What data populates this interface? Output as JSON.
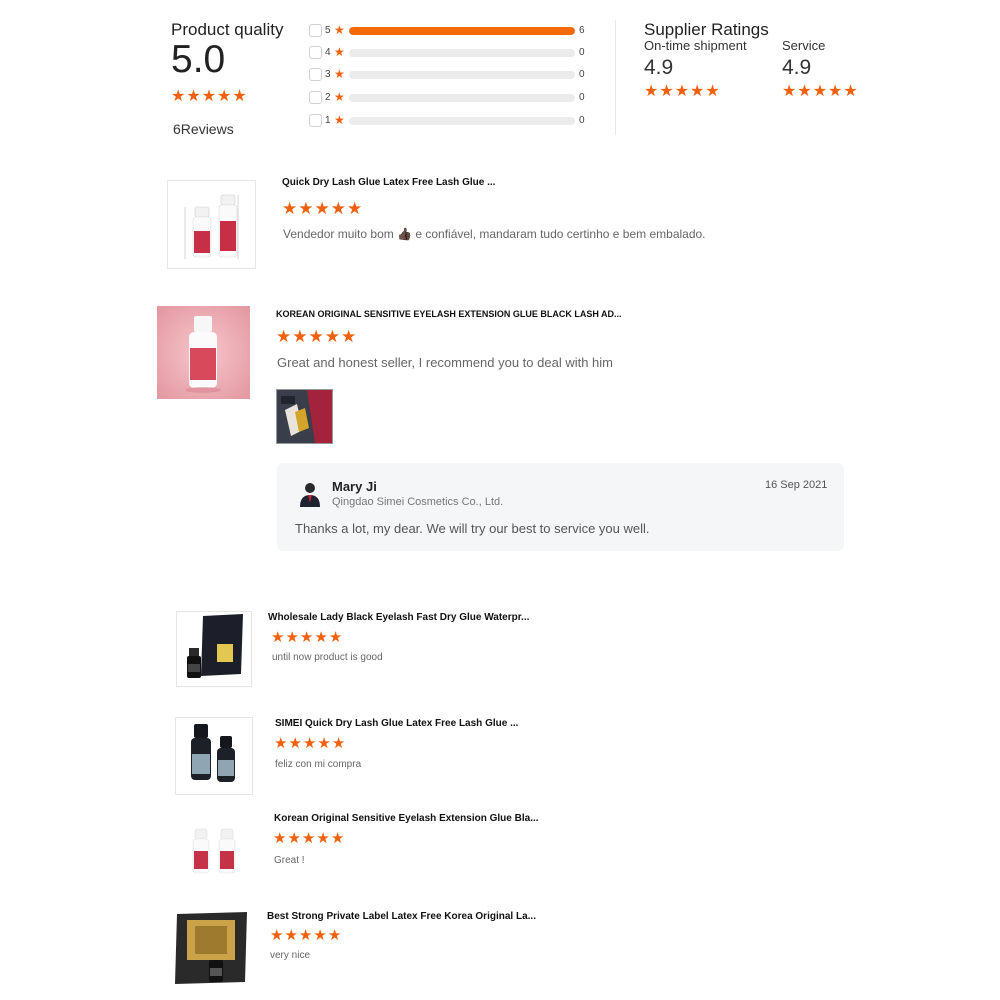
{
  "summary": {
    "title": "Product quality",
    "score": "5.0",
    "reviews_count": "6",
    "reviews_label": "Reviews",
    "distribution": [
      {
        "stars": "5",
        "count": "6",
        "fraction": 1.0
      },
      {
        "stars": "4",
        "count": "0",
        "fraction": 0
      },
      {
        "stars": "3",
        "count": "0",
        "fraction": 0
      },
      {
        "stars": "2",
        "count": "0",
        "fraction": 0
      },
      {
        "stars": "1",
        "count": "0",
        "fraction": 0
      }
    ]
  },
  "supplier": {
    "title": "Supplier Ratings",
    "shipment_label": "On-time shipment",
    "shipment_score": "4.9",
    "service_label": "Service",
    "service_score": "4.9"
  },
  "star_glyph": "★",
  "colors": {
    "accent": "#f0600d",
    "bar_fill": "#f46a0a",
    "reply_bg": "#f5f6f7"
  },
  "reviews": [
    {
      "product": "Quick Dry Lash Glue Latex Free Lash Glue ...",
      "rating": 5,
      "text": "Vendedor muito bom 👍🏿 e confiável,  mandaram tudo certinho e bem embalado."
    },
    {
      "product": "KOREAN ORIGINAL SENSITIVE EYELASH EXTENSION GLUE BLACK LASH AD...",
      "rating": 5,
      "text": "Great and honest seller, I recommend you to deal with him",
      "reply": {
        "name": "Mary Ji",
        "company": "Qingdao Simei Cosmetics Co., Ltd.",
        "date": "16 Sep 2021",
        "text": "Thanks a lot, my dear. We will try our best to service you well."
      }
    },
    {
      "product": "Wholesale Lady Black Eyelash Fast Dry Glue Waterpr...",
      "rating": 5,
      "text": "until now product is good"
    },
    {
      "product": "SIMEI Quick Dry Lash Glue Latex Free Lash Glue        ...",
      "rating": 5,
      "text": "feliz con mi compra"
    },
    {
      "product": "Korean Original Sensitive Eyelash Extension Glue Bla...",
      "rating": 5,
      "text": "Great !"
    },
    {
      "product": "Best Strong Private Label Latex Free Korea Original La...",
      "rating": 5,
      "text": "very nice"
    }
  ]
}
